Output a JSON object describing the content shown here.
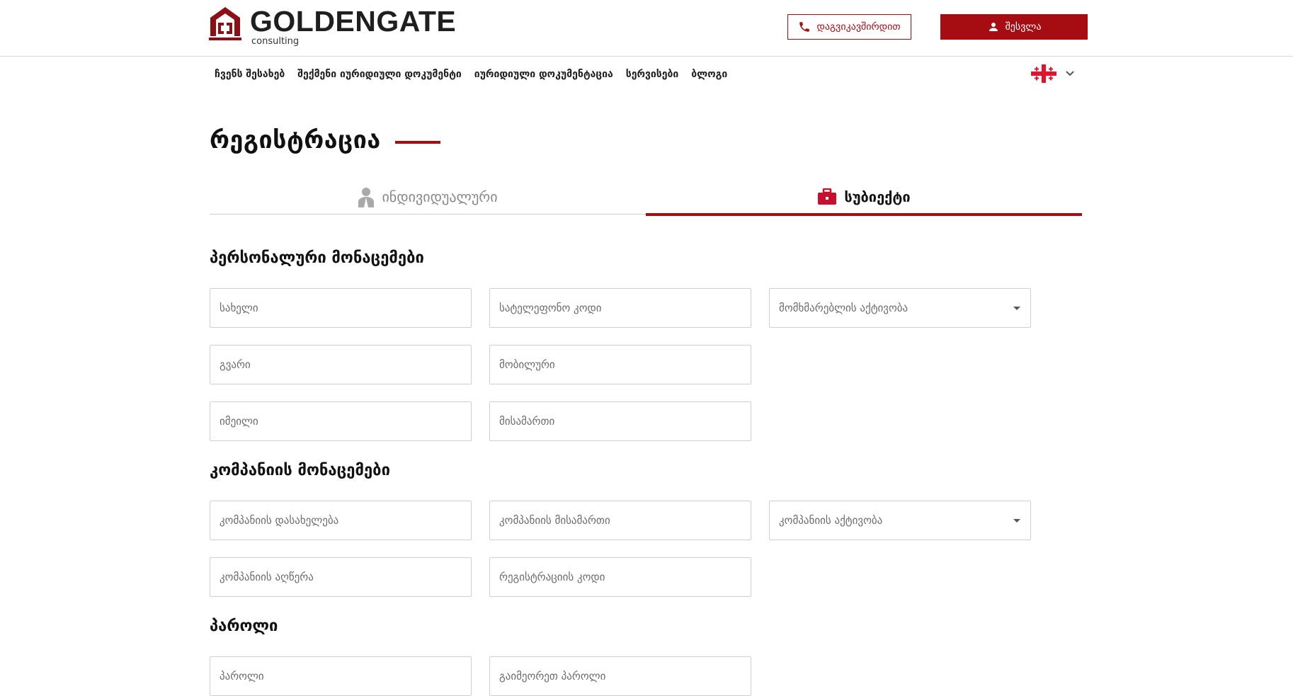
{
  "header": {
    "logo_name": "GOLDENGATE",
    "logo_sub": "consulting",
    "contact_label": "დაგვიკავშირდით",
    "login_label": "შესვლა"
  },
  "nav": {
    "items": [
      "ჩვენს შესახებ",
      "შექმენი იურიდიული დოკუმენტი",
      "იურიდიული დოკუმენტაცია",
      "სერვისები",
      "ბლოგი"
    ],
    "language_icon": "georgian-flag-icon"
  },
  "page": {
    "title": "რეგისტრაცია"
  },
  "tabs": {
    "individual_label": "ინდივიდუალური",
    "entity_label": "სუბიექტი",
    "active": "entity"
  },
  "sections": {
    "personal_title": "პერსონალური მონაცემები",
    "company_title": "კომპანიის მონაცემები",
    "password_title": "პაროლი"
  },
  "fields": {
    "first_name": "სახელი",
    "phone_code": "სატელეფონო კოდი",
    "user_activity": "მომხმარებლის აქტივობა",
    "last_name": "გვარი",
    "mobile": "მობილური",
    "email": "იმეილი",
    "address": "მისამართი",
    "company_name": "კომპანიის დასახელება",
    "company_address": "კომპანიის მისამართი",
    "company_activity": "კომპანიის აქტივობა",
    "company_description": "კომპანიის აღწერა",
    "registration_code": "რეგისტრაციის კოდი",
    "password": "პაროლი",
    "repeat_password": "გაიმეორეთ პაროლი"
  },
  "colors": {
    "accent": "#a50d12",
    "border": "#cfcfcf",
    "text": "#1a1a1a"
  }
}
